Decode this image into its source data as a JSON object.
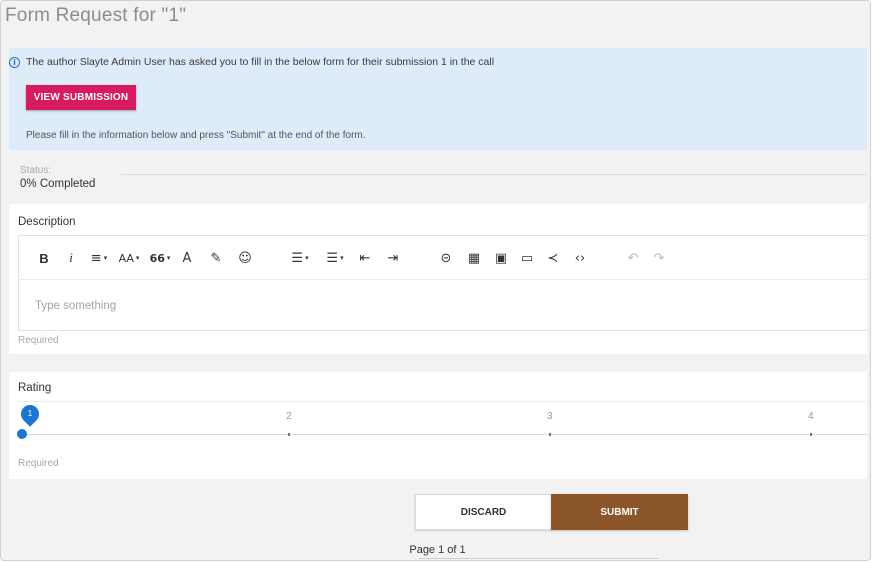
{
  "page": {
    "title": "Form Request for \"1\""
  },
  "info": {
    "message": "The author Slayte Admin User has asked you to fill in the below form for their submission 1 in the call",
    "button_label": "VIEW SUBMISSION",
    "hint": "Please fill in the information below and press \"Submit\" at the end of the form.",
    "icon": "info-icon"
  },
  "status": {
    "label": "Status:",
    "value": "0% Completed"
  },
  "description": {
    "label": "Description",
    "placeholder": "Type something",
    "required": "Required",
    "toolbar": {
      "bold": "B",
      "italic": "i",
      "align": "≡",
      "font_size": "AA",
      "quote": "66",
      "caret": "▾",
      "font_color": "A",
      "highlight": "✎",
      "emoji": "☺",
      "bullet_list": "☰",
      "numbered_list": "☰",
      "outdent": "⇤",
      "indent": "⇥",
      "link": "⊝",
      "table": "▦",
      "image": "▣",
      "video": "▭",
      "share": "≺",
      "code": "‹›",
      "undo": "↶",
      "redo": "↷"
    }
  },
  "rating": {
    "label": "Rating",
    "required": "Required",
    "value": 1,
    "ticks": [
      "2",
      "3",
      "4"
    ],
    "bubble": "1"
  },
  "actions": {
    "discard": "DISCARD",
    "submit": "SUBMIT"
  },
  "pager": {
    "text": "Page 1 of 1"
  },
  "colors": {
    "accent_pink": "#d81b60",
    "submit_brown": "#8b572a",
    "info_bg": "#deebf8",
    "slider_blue": "#1976d2"
  }
}
